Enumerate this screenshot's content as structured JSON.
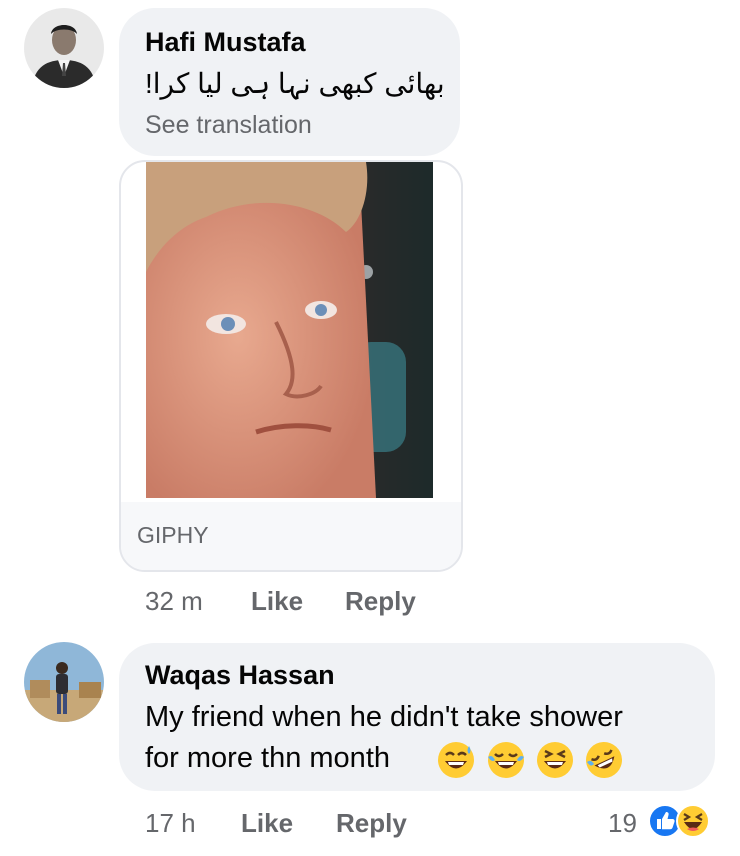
{
  "comments": [
    {
      "author": "Hafi Mustafa",
      "text": "بھائی کبھی نہا ہی لیا کرا!",
      "see_translation": "See translation",
      "attachment_source": "GIPHY",
      "time": "32 m",
      "like_label": "Like",
      "reply_label": "Reply"
    },
    {
      "author": "Waqas Hassan",
      "text_line1": "My friend when he didn't take shower",
      "text_line2": "for more thn month",
      "emojis": [
        "sweat-smile-emoji",
        "joy-emoji",
        "laughing-emoji",
        "rofl-emoji"
      ],
      "time": "17 h",
      "like_label": "Like",
      "reply_label": "Reply",
      "reaction_count": "19",
      "reactions": [
        "like-reaction-icon",
        "haha-reaction-icon"
      ]
    }
  ],
  "colors": {
    "bubble_bg": "#f0f2f5",
    "meta_text": "#65676b",
    "like_blue": "#1877f2",
    "emoji_yellow": "#ffcc33"
  }
}
